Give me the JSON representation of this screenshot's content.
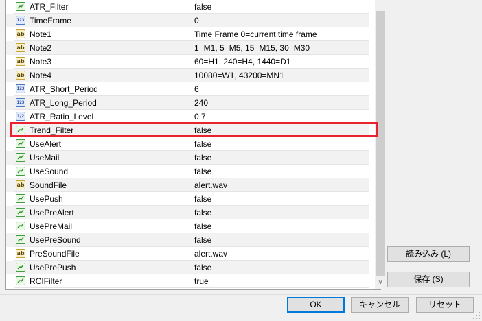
{
  "params": [
    {
      "type": "bool",
      "name": "ATR_Filter",
      "value": "false"
    },
    {
      "type": "int",
      "name": "TimeFrame",
      "value": "0"
    },
    {
      "type": "str",
      "name": "Note1",
      "value": "Time Frame 0=current time frame"
    },
    {
      "type": "str",
      "name": "Note2",
      "value": "1=M1, 5=M5, 15=M15, 30=M30"
    },
    {
      "type": "str",
      "name": "Note3",
      "value": "60=H1, 240=H4, 1440=D1"
    },
    {
      "type": "str",
      "name": "Note4",
      "value": "10080=W1, 43200=MN1"
    },
    {
      "type": "int",
      "name": "ATR_Short_Period",
      "value": "6"
    },
    {
      "type": "int",
      "name": "ATR_Long_Period",
      "value": "240"
    },
    {
      "type": "dbl",
      "name": "ATR_Ratio_Level",
      "value": "0.7"
    },
    {
      "type": "bool",
      "name": "Trend_Filter",
      "value": "false"
    },
    {
      "type": "bool",
      "name": "UseAlert",
      "value": "false"
    },
    {
      "type": "bool",
      "name": "UseMail",
      "value": "false"
    },
    {
      "type": "bool",
      "name": "UseSound",
      "value": "false"
    },
    {
      "type": "str",
      "name": "SoundFile",
      "value": "alert.wav"
    },
    {
      "type": "bool",
      "name": "UsePush",
      "value": "false"
    },
    {
      "type": "bool",
      "name": "UsePreAlert",
      "value": "false"
    },
    {
      "type": "bool",
      "name": "UsePreMail",
      "value": "false"
    },
    {
      "type": "bool",
      "name": "UsePreSound",
      "value": "false"
    },
    {
      "type": "str",
      "name": "PreSoundFile",
      "value": "alert.wav"
    },
    {
      "type": "bool",
      "name": "UsePrePush",
      "value": "false"
    },
    {
      "type": "bool",
      "name": "RCIFilter",
      "value": "true"
    }
  ],
  "icon_text": {
    "int": "123",
    "str": "ab",
    "dbl": "1/2"
  },
  "highlighted_param": "Trend_Filter",
  "side_buttons": {
    "load": "読み込み (L)",
    "save": "保存 (S)"
  },
  "bottom_buttons": {
    "ok": "OK",
    "cancel": "キャンセル",
    "reset": "リセット"
  },
  "colors": {
    "highlight": "#e8222e",
    "ok_border": "#0078d7"
  }
}
